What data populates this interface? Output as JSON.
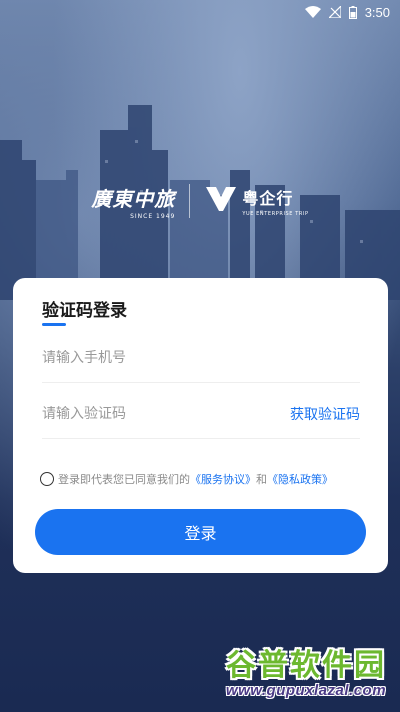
{
  "status_bar": {
    "time": "3:50",
    "icons": [
      "wifi-icon",
      "signal-off-icon",
      "battery-icon"
    ]
  },
  "logos": {
    "brand1": "廣東中旅",
    "brand1_since": "SINCE 1949",
    "brand2": "粤企行",
    "brand2_sub": "YUE ENTERPRISE TRIP"
  },
  "login": {
    "title": "验证码登录",
    "phone_placeholder": "请输入手机号",
    "code_placeholder": "请输入验证码",
    "get_code_label": "获取验证码",
    "agreement_prefix": "登录即代表您已同意我们的",
    "service_agreement": "《服务协议》",
    "and": "和",
    "privacy_policy": "《隐私政策》",
    "login_button": "登录"
  },
  "watermark": {
    "title": "谷普软件园",
    "url": "www.gupuxlazal.com"
  },
  "colors": {
    "accent": "#1a73f0",
    "watermark_green": "#6cb82f",
    "watermark_purple": "#4a3a86"
  }
}
